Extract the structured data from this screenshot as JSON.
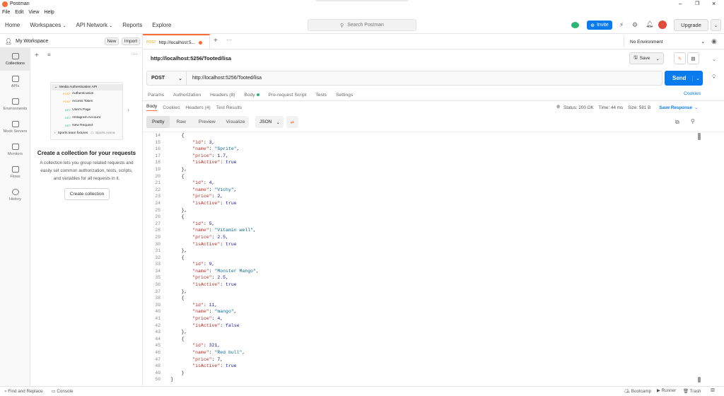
{
  "app": {
    "title": "Postman",
    "menu": [
      "File",
      "Edit",
      "View",
      "Help"
    ]
  },
  "topnav": {
    "items": [
      "Home",
      "Workspaces",
      "API Network",
      "Reports",
      "Explore"
    ],
    "search": "Search Postman",
    "invite": "Invite",
    "upgrade": "Upgrade"
  },
  "workspace": {
    "name": "My Workspace",
    "new": "New",
    "import": "Import"
  },
  "rail": [
    {
      "label": "Collections"
    },
    {
      "label": "APIs"
    },
    {
      "label": "Environments"
    },
    {
      "label": "Mock Servers"
    },
    {
      "label": "Monitors"
    },
    {
      "label": "Flows"
    },
    {
      "label": "History"
    }
  ],
  "empty": {
    "title": "Create a collection for your requests",
    "desc1": "A collection lets you group related requests and",
    "desc2": "easily set common authorization, tests, scripts,",
    "desc3": "and variables for all requests in it.",
    "button": "Create collection"
  },
  "illustration": {
    "root": "Media Authentication API",
    "items": [
      {
        "m": "POST",
        "t": "Authentication"
      },
      {
        "m": "POST",
        "t": "Access Token"
      },
      {
        "m": "GET",
        "t": "User's Page"
      },
      {
        "m": "GET",
        "t": "Instagram Account"
      },
      {
        "m": "GET",
        "t": "New Request"
      }
    ],
    "folder": "Sports team fixtures",
    "folder2": "Sports Arena"
  },
  "tab": {
    "method": "POST",
    "label": "http://localhost:5...",
    "env": "No Environment"
  },
  "request": {
    "title": "http://localhost:5256/Tooted/lisa",
    "method": "POST",
    "url": "http://localhost:5256/Tooted/lisa",
    "send": "Send",
    "save": "Save"
  },
  "reqtabs": [
    "Params",
    "Authorization",
    "Headers (8)",
    "Body",
    "Pre-request Script",
    "Tests",
    "Settings"
  ],
  "cookies": "Cookies",
  "restabs": [
    "Body",
    "Cookies",
    "Headers (4)",
    "Test Results"
  ],
  "status": {
    "status": "Status: 200 OK",
    "time": "Time: 44 ms",
    "size": "Size: 581 B",
    "save": "Save Response"
  },
  "viewtabs": [
    "Pretty",
    "Raw",
    "Preview",
    "Visualize"
  ],
  "format": "JSON",
  "code": [
    {
      "n": "14",
      "t": "    {"
    },
    {
      "n": "15",
      "k": "\"id\"",
      "v": "3",
      "vt": "n",
      "c": ","
    },
    {
      "n": "16",
      "k": "\"name\"",
      "v": "\"Sprite\"",
      "vt": "s",
      "c": ","
    },
    {
      "n": "17",
      "k": "\"price\"",
      "v": "1.7",
      "vt": "n",
      "c": ","
    },
    {
      "n": "18",
      "k": "\"isActive\"",
      "v": "true",
      "vt": "n",
      "c": ""
    },
    {
      "n": "19",
      "t": "    },"
    },
    {
      "n": "20",
      "t": "    {"
    },
    {
      "n": "21",
      "k": "\"id\"",
      "v": "4",
      "vt": "n",
      "c": ","
    },
    {
      "n": "22",
      "k": "\"name\"",
      "v": "\"Vichy\"",
      "vt": "s",
      "c": ","
    },
    {
      "n": "23",
      "k": "\"price\"",
      "v": "2",
      "vt": "n",
      "c": ","
    },
    {
      "n": "24",
      "k": "\"isActive\"",
      "v": "true",
      "vt": "n",
      "c": ""
    },
    {
      "n": "25",
      "t": "    },"
    },
    {
      "n": "26",
      "t": "    {"
    },
    {
      "n": "27",
      "k": "\"id\"",
      "v": "5",
      "vt": "n",
      "c": ","
    },
    {
      "n": "28",
      "k": "\"name\"",
      "v": "\"Vitamin well\"",
      "vt": "s",
      "c": ","
    },
    {
      "n": "29",
      "k": "\"price\"",
      "v": "2.5",
      "vt": "n",
      "c": ","
    },
    {
      "n": "30",
      "k": "\"isActive\"",
      "v": "true",
      "vt": "n",
      "c": ""
    },
    {
      "n": "31",
      "t": "    },"
    },
    {
      "n": "32",
      "t": "    {"
    },
    {
      "n": "33",
      "k": "\"id\"",
      "v": "9",
      "vt": "n",
      "c": ","
    },
    {
      "n": "34",
      "k": "\"name\"",
      "v": "\"Monster Mango\"",
      "vt": "s",
      "c": ","
    },
    {
      "n": "35",
      "k": "\"price\"",
      "v": "2.5",
      "vt": "n",
      "c": ","
    },
    {
      "n": "36",
      "k": "\"isActive\"",
      "v": "true",
      "vt": "n",
      "c": ""
    },
    {
      "n": "37",
      "t": "    },"
    },
    {
      "n": "38",
      "t": "    {"
    },
    {
      "n": "39",
      "k": "\"id\"",
      "v": "11",
      "vt": "n",
      "c": ","
    },
    {
      "n": "40",
      "k": "\"name\"",
      "v": "\"mango\"",
      "vt": "s",
      "c": ","
    },
    {
      "n": "41",
      "k": "\"price\"",
      "v": "4",
      "vt": "n",
      "c": ","
    },
    {
      "n": "42",
      "k": "\"isActive\"",
      "v": "false",
      "vt": "n",
      "c": ""
    },
    {
      "n": "43",
      "t": "    },"
    },
    {
      "n": "44",
      "t": "    {"
    },
    {
      "n": "45",
      "k": "\"id\"",
      "v": "321",
      "vt": "n",
      "c": ","
    },
    {
      "n": "46",
      "k": "\"name\"",
      "v": "\"Red bull\"",
      "vt": "s",
      "c": ","
    },
    {
      "n": "47",
      "k": "\"price\"",
      "v": "7",
      "vt": "n",
      "c": ","
    },
    {
      "n": "48",
      "k": "\"isActive\"",
      "v": "true",
      "vt": "n",
      "c": ""
    },
    {
      "n": "49",
      "t": "    }"
    },
    {
      "n": "50",
      "t": "]"
    }
  ],
  "statusbar": {
    "find": "Find and Replace",
    "console": "Console",
    "bootcamp": "Bootcamp",
    "runner": "Runner",
    "trash": "Trash"
  },
  "colors": {
    "accent": "#ff6c37",
    "send": "#097bed",
    "invite": "#097bed"
  }
}
